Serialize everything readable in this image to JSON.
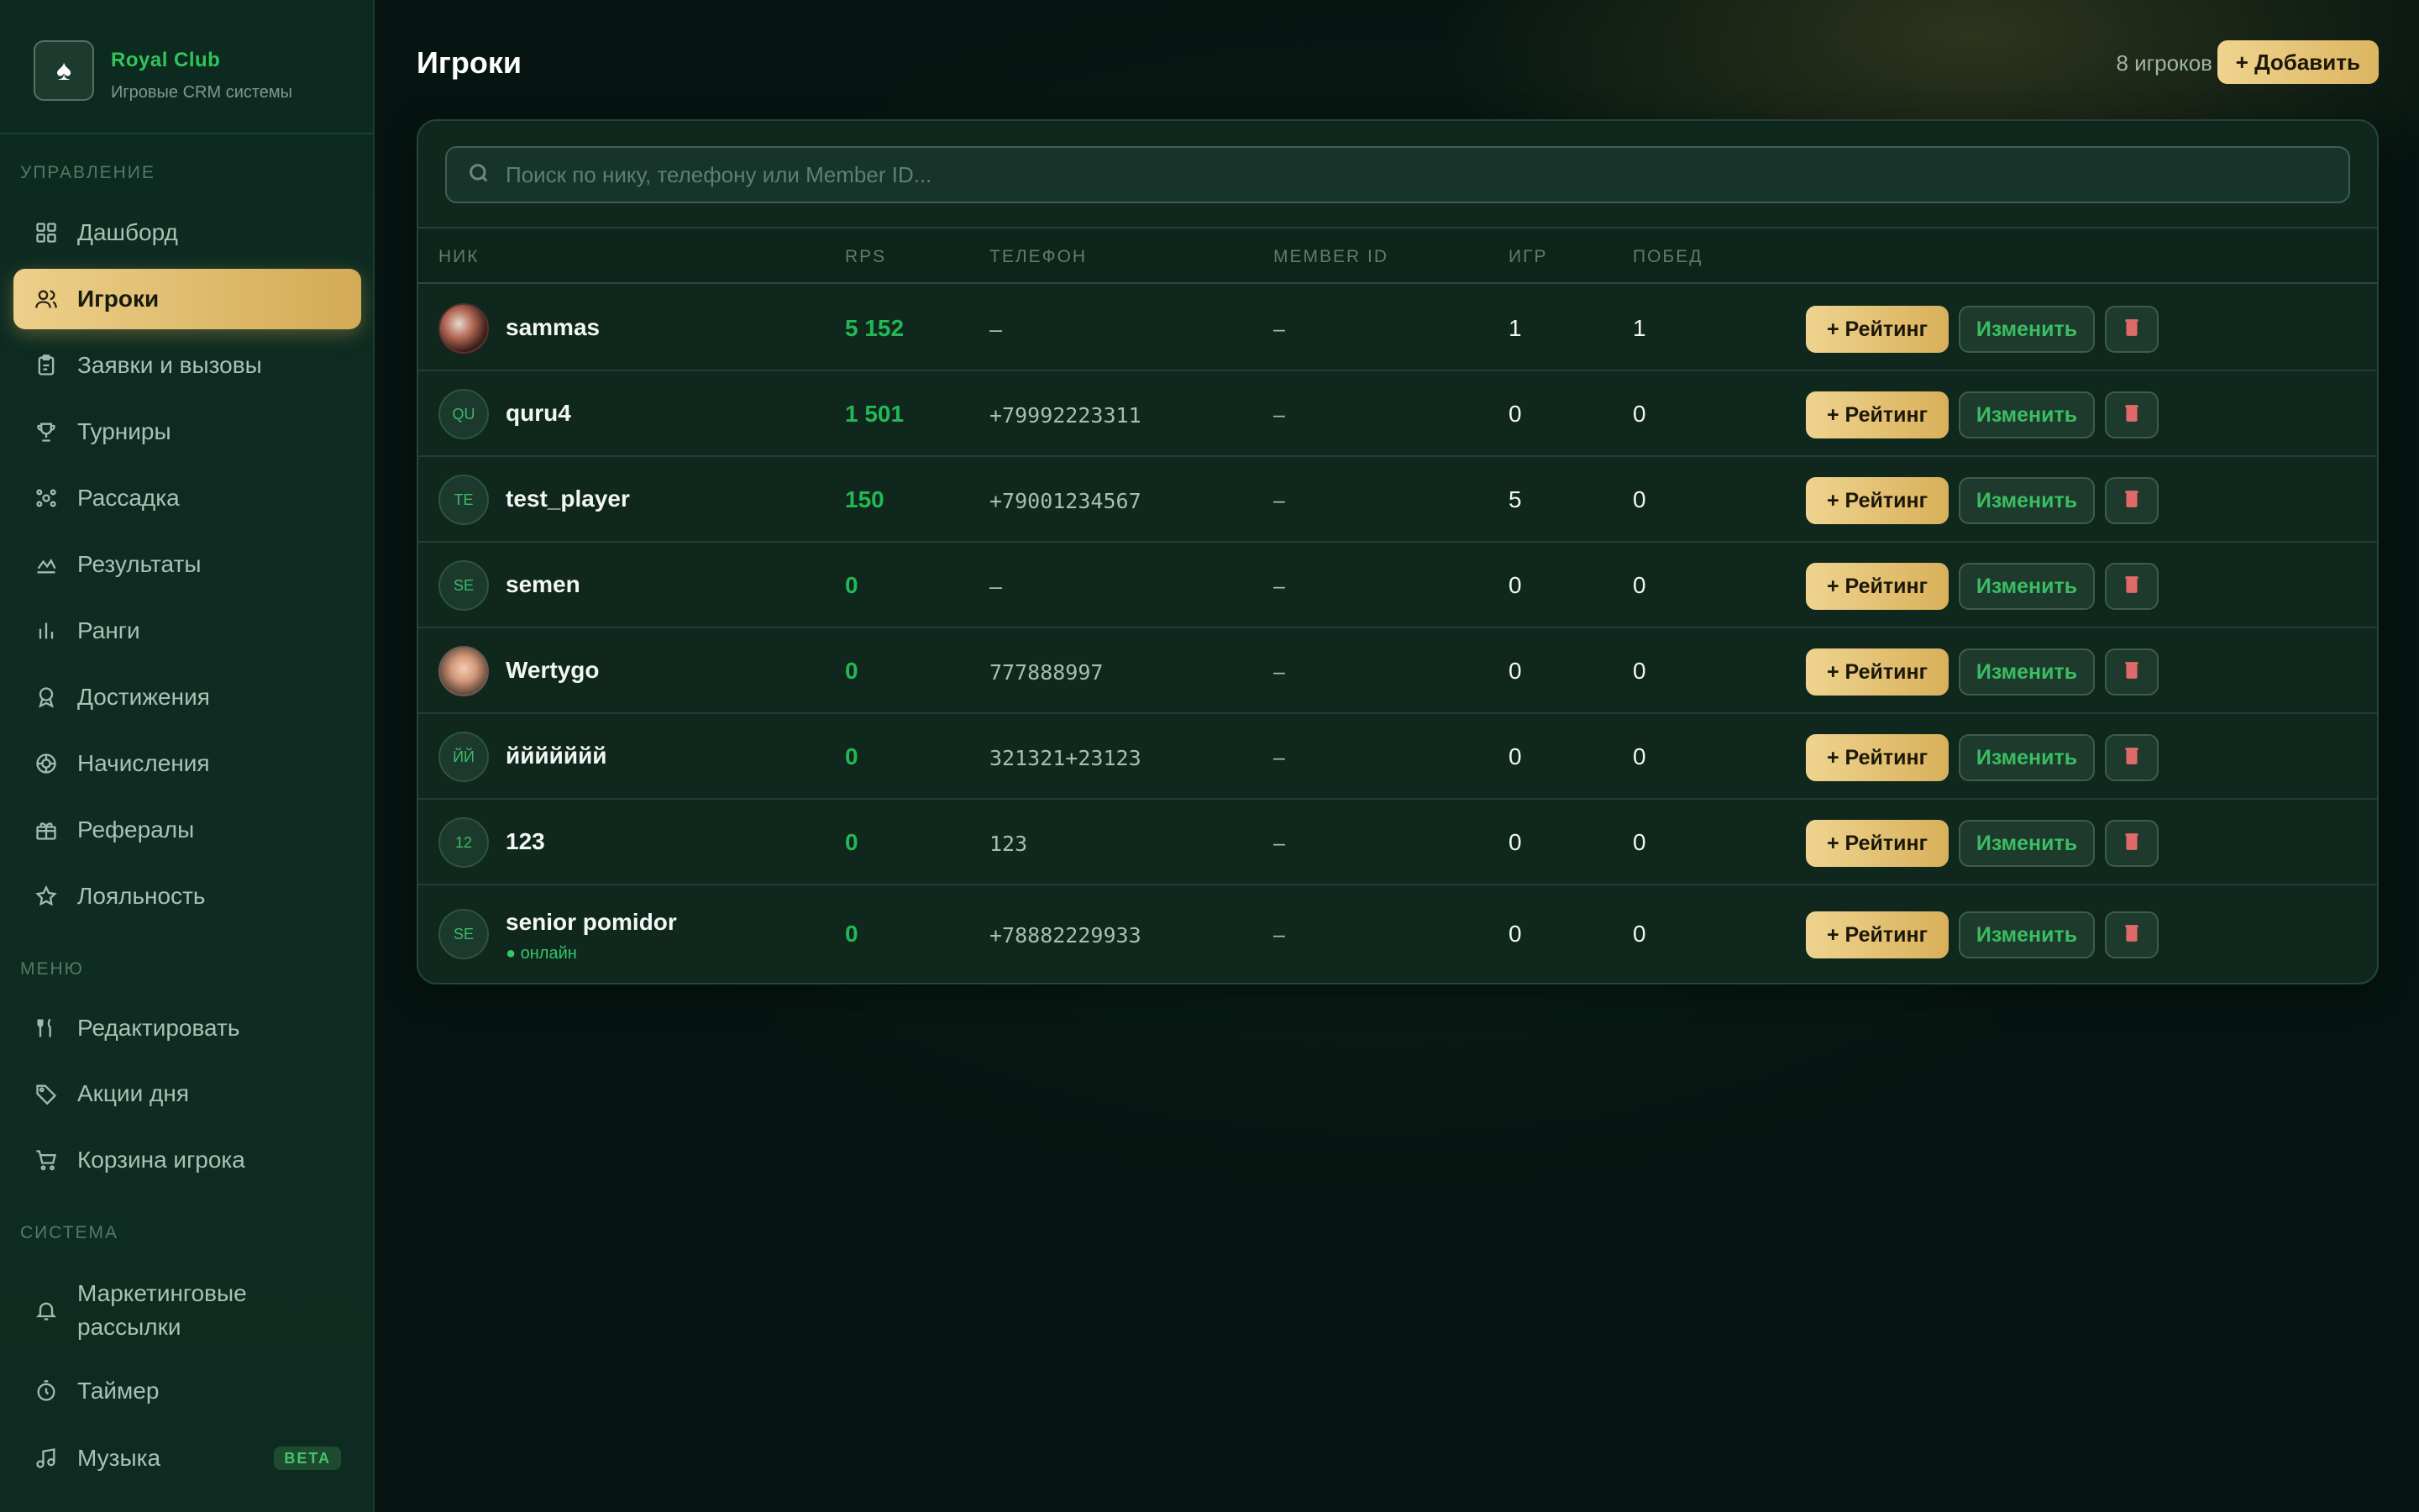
{
  "brand": {
    "name": "Royal Club",
    "subtitle": "Игровые CRM системы",
    "logo_icon": "spade-icon"
  },
  "sidebar": {
    "sections": [
      {
        "label": "Управление"
      },
      {
        "label": "Меню"
      },
      {
        "label": "Система"
      }
    ],
    "items": [
      {
        "label": "Дашборд",
        "icon": "grid-icon"
      },
      {
        "label": "Игроки",
        "icon": "users-icon",
        "active": true
      },
      {
        "label": "Заявки и вызовы",
        "icon": "clipboard-icon"
      },
      {
        "label": "Турниры",
        "icon": "trophy-icon"
      },
      {
        "label": "Рассадка",
        "icon": "seating-icon"
      },
      {
        "label": "Результаты",
        "icon": "chart-line-icon"
      },
      {
        "label": "Ранги",
        "icon": "bar-chart-icon"
      },
      {
        "label": "Достижения",
        "icon": "award-icon"
      },
      {
        "label": "Начисления",
        "icon": "chip-icon"
      },
      {
        "label": "Рефералы",
        "icon": "gift-icon"
      },
      {
        "label": "Лояльность",
        "icon": "star-icon"
      },
      {
        "label": "Редактировать",
        "icon": "utensils-icon"
      },
      {
        "label": "Акции дня",
        "icon": "tag-icon"
      },
      {
        "label": "Корзина игрока",
        "icon": "cart-icon"
      },
      {
        "label": "Маркетинговые рассылки",
        "icon": "bell-icon"
      },
      {
        "label": "Таймер",
        "icon": "timer-icon"
      },
      {
        "label": "Музыка",
        "icon": "music-icon",
        "badge": "BETA"
      }
    ]
  },
  "header": {
    "title": "Игроки",
    "count": "8 игроков",
    "add_label": "+ Добавить"
  },
  "search": {
    "placeholder": "Поиск по нику, телефону или Member ID..."
  },
  "table": {
    "columns": [
      "Ник",
      "RPS",
      "Телефон",
      "Member ID",
      "Игр",
      "Побед"
    ],
    "rating_label": "+ Рейтинг",
    "edit_label": "Изменить",
    "rows": [
      {
        "initials": "",
        "avatar": "photo",
        "nick": "sammas",
        "rps": "5 152",
        "phone": "–",
        "member_id": "–",
        "games": "1",
        "wins": "1"
      },
      {
        "initials": "QU",
        "nick": "quru4",
        "rps": "1 501",
        "phone": "+79992223311",
        "member_id": "–",
        "games": "0",
        "wins": "0"
      },
      {
        "initials": "TE",
        "nick": "test_player",
        "rps": "150",
        "phone": "+79001234567",
        "member_id": "–",
        "games": "5",
        "wins": "0"
      },
      {
        "initials": "SE",
        "nick": "semen",
        "rps": "0",
        "phone": "–",
        "member_id": "–",
        "games": "0",
        "wins": "0"
      },
      {
        "initials": "",
        "avatar": "photo",
        "nick": "Wertygo",
        "rps": "0",
        "phone": "777888997",
        "member_id": "–",
        "games": "0",
        "wins": "0"
      },
      {
        "initials": "ЙЙ",
        "nick": "ййййййй",
        "rps": "0",
        "phone": "321321+23123",
        "member_id": "–",
        "games": "0",
        "wins": "0"
      },
      {
        "initials": "12",
        "nick": "123",
        "rps": "0",
        "phone": "123",
        "member_id": "–",
        "games": "0",
        "wins": "0"
      },
      {
        "initials": "SE",
        "nick": "senior pomidor",
        "status": "● онлайн",
        "rps": "0",
        "phone": "+78882229933",
        "member_id": "–",
        "games": "0",
        "wins": "0"
      }
    ]
  },
  "colors": {
    "accent_gold": "#e4c274",
    "accent_green": "#22b855",
    "danger": "#d9534f"
  }
}
